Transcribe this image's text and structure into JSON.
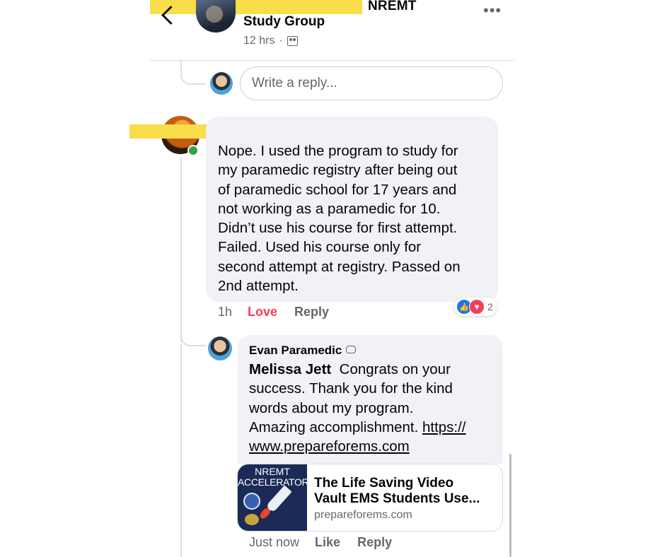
{
  "header": {
    "group_title_line1": "NREMT",
    "group_title_line2": "Study Group",
    "time": "12 hrs",
    "dot": "·",
    "more": "•••"
  },
  "reply_box": {
    "placeholder": "Write a reply..."
  },
  "comment": {
    "lines": [
      "Nope. I used the program to study for",
      "my paramedic registry after being out",
      "of paramedic school for 17 years and",
      "not working as a paramedic for 10.",
      "Didn’t use his course for first attempt.",
      "Failed. Used his course only for",
      "second attempt at registry. Passed on",
      "2nd attempt."
    ],
    "time": "1h",
    "love_label": "Love",
    "reply_label": "Reply",
    "reaction_count": "2"
  },
  "reply": {
    "author": "Evan Paramedic",
    "mention": "Melissa Jett",
    "line1": "Congrats on your",
    "line2": "success. Thank you for the kind",
    "line3": "words about my program.",
    "line4": "Amazing accomplishment.",
    "link_part1": "https://",
    "link_part2": "www.prepareforems.com",
    "time": "Just now",
    "like_label": "Like",
    "reply_label": "Reply"
  },
  "link_preview": {
    "thumb_line1": "NREMT",
    "thumb_line2": "ACCELERATOR",
    "title_line1": "The Life Saving Video",
    "title_line2": "Vault EMS Students Use...",
    "domain": "prepareforems.com"
  }
}
